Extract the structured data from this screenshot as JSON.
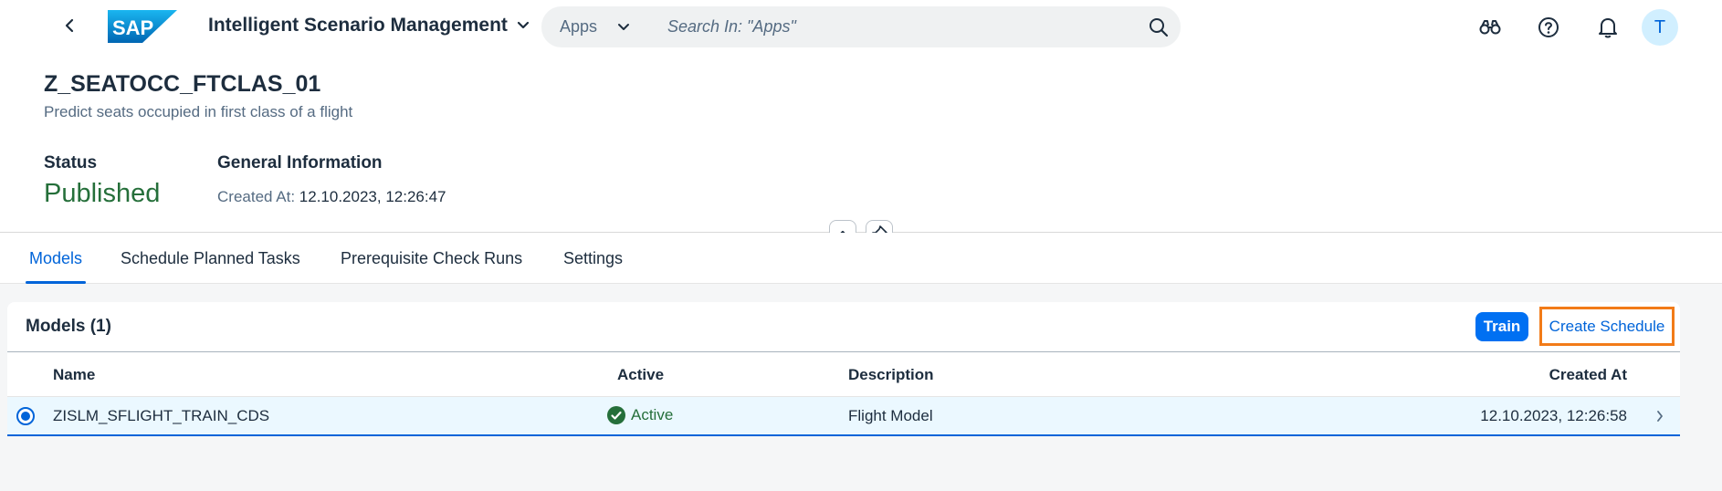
{
  "shell": {
    "app_title": "Intelligent Scenario Management",
    "search_scope": "Apps",
    "search_placeholder": "Search In: \"Apps\"",
    "avatar_initial": "T",
    "icons": [
      "back-arrow",
      "sap-logo",
      "chevron-down",
      "search",
      "binoculars",
      "help",
      "bell"
    ]
  },
  "header": {
    "title": "Z_SEATOCC_FTCLAS_01",
    "subtitle": "Predict seats occupied in first class of a flight",
    "status_label": "Status",
    "status_value": "Published",
    "general_info_label": "General Information",
    "created_at_label": "Created At:",
    "created_at_value": "12.10.2023, 12:26:47"
  },
  "tabs": [
    {
      "label": "Models",
      "active": true
    },
    {
      "label": "Schedule Planned Tasks",
      "active": false
    },
    {
      "label": "Prerequisite Check Runs",
      "active": false
    },
    {
      "label": "Settings",
      "active": false
    }
  ],
  "models_table": {
    "title": "Models (1)",
    "train_label": "Train",
    "create_schedule_label": "Create Schedule",
    "columns": [
      "Name",
      "Active",
      "Description",
      "Created At"
    ],
    "rows": [
      {
        "name": "ZISLM_SFLIGHT_TRAIN_CDS",
        "active": "Active",
        "description": "Flight Model",
        "created_at": "12.10.2023, 12:26:58",
        "selected": true
      }
    ]
  },
  "colors": {
    "accent": "#0064d9",
    "button": "#0070f2",
    "success": "#256f3a",
    "highlight": "#f27b18",
    "selected_row": "#ebf8ff"
  }
}
